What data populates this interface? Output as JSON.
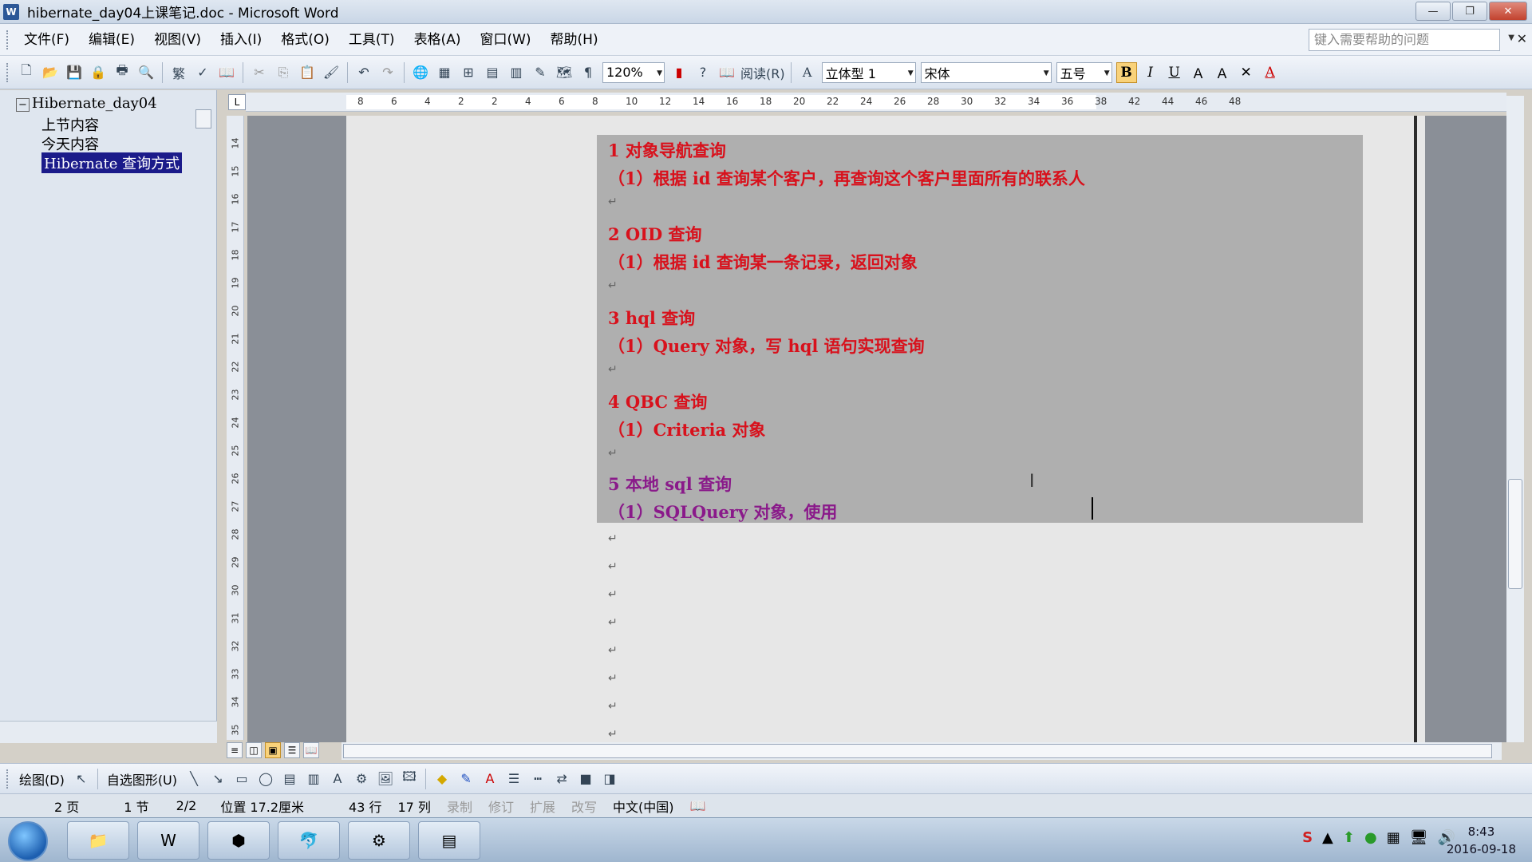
{
  "window": {
    "title": "hibernate_day04上课笔记.doc - Microsoft Word",
    "app_icon": "word-icon",
    "buttons": {
      "minimize": "—",
      "restore": "❐",
      "close": "✕"
    }
  },
  "menu": {
    "items": [
      "文件(F)",
      "编辑(E)",
      "视图(V)",
      "插入(I)",
      "格式(O)",
      "工具(T)",
      "表格(A)",
      "窗口(W)",
      "帮助(H)"
    ],
    "help_placeholder": "键入需要帮助的问题"
  },
  "toolbar": {
    "zoom": "120%",
    "read_label": "阅读(R)",
    "style": "立体型 1",
    "font": "宋体",
    "font_size": "五号",
    "bold": "B",
    "italic": "I",
    "underline": "U",
    "traditional": "繁"
  },
  "nav_pane": {
    "root": "Hibernate_day04",
    "items": [
      "上节内容",
      "今天内容",
      "Hibernate 查询方式"
    ],
    "selected_index": 2
  },
  "ruler": {
    "h_ticks": [
      "8",
      "6",
      "4",
      "2",
      "2",
      "4",
      "6",
      "8",
      "10",
      "12",
      "14",
      "16",
      "18",
      "20",
      "22",
      "24",
      "26",
      "28",
      "30",
      "32",
      "34",
      "36",
      "38",
      "42",
      "44",
      "46",
      "48"
    ],
    "v_ticks": [
      "14",
      "15",
      "16",
      "17",
      "18",
      "19",
      "20",
      "21",
      "22",
      "23",
      "24",
      "25",
      "26",
      "27",
      "28",
      "29",
      "30",
      "31",
      "32",
      "33",
      "34",
      "35"
    ]
  },
  "document": {
    "lines": [
      "1  对象导航查询",
      "（1）根据 id 查询某个客户，再查询这个客户里面所有的联系人",
      "2 OID 查询",
      "（1）根据 id 查询某一条记录，返回对象",
      "3 hql 查询",
      "（1）Query 对象，写 hql 语句实现查询",
      "4 QBC 查询",
      "（1）Criteria 对象",
      "5  本地 sql 查询",
      "（1）SQLQuery 对象，使用"
    ],
    "paragraph_mark": "↵"
  },
  "draw_toolbar": {
    "draw_label": "绘图(D)",
    "autoshape_label": "自选图形(U)"
  },
  "status": {
    "page": "2 页",
    "section": "1 节",
    "page_of": "2/2",
    "position": "位置 17.2厘米",
    "line": "43 行",
    "column": "17 列",
    "rec": "录制",
    "trk": "修订",
    "ext": "扩展",
    "ovr": "改写",
    "language": "中文(中国)"
  },
  "taskbar": {
    "time": "8:43",
    "date": "2016-09-18"
  },
  "colors": {
    "heading_red": "#d8111c",
    "heading_purple": "#8a1a8a",
    "selection_gray": "#afafaf",
    "nav_selected": "#1b1b8a"
  }
}
